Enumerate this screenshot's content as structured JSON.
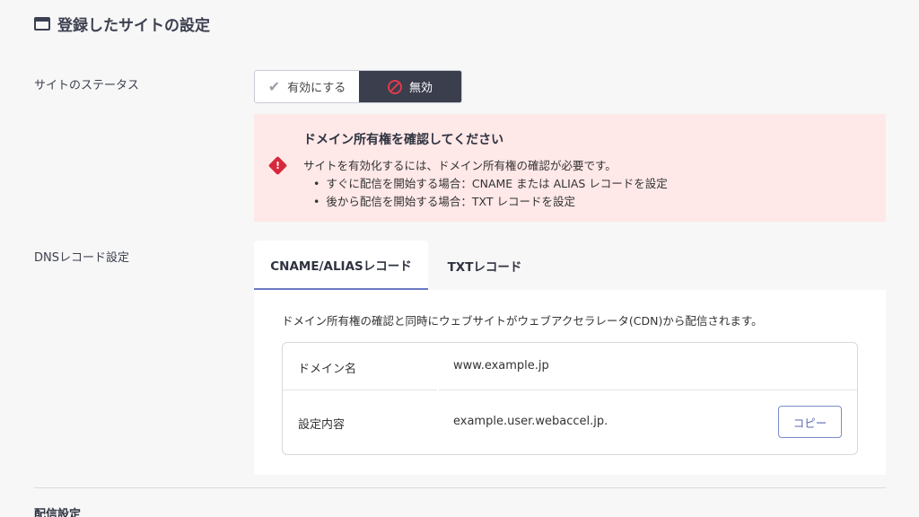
{
  "header": {
    "title": "登録したサイトの設定",
    "icon": "window-icon"
  },
  "status": {
    "label": "サイトのステータス",
    "options": [
      {
        "label": "有効にする",
        "icon": "check-icon",
        "selected": false
      },
      {
        "label": "無効",
        "icon": "ban-icon",
        "selected": true
      }
    ]
  },
  "alert": {
    "title": "ドメイン所有権を確認してください",
    "message": "サイトを有効化するには、ドメイン所有権の確認が必要です。",
    "bullets": [
      "すぐに配信を開始する場合：CNAME または ALIAS レコードを設定",
      "後から配信を開始する場合：TXT レコードを設定"
    ],
    "icon": "warning-icon",
    "color": "#d8283b"
  },
  "dns": {
    "label": "DNSレコード設定",
    "tabs": [
      {
        "label": "CNAME/ALIASレコード",
        "active": true
      },
      {
        "label": "TXTレコード",
        "active": false
      }
    ],
    "description": "ドメイン所有権の確認と同時にウェブサイトがウェブアクセラレータ(CDN)から配信されます。",
    "rows": [
      {
        "key": "ドメイン名",
        "value": "www.example.jp"
      },
      {
        "key": "設定内容",
        "value": "example.user.webaccel.jp."
      }
    ],
    "copy_label": "コピー"
  },
  "footer": {
    "section_title": "配信設定"
  },
  "colors": {
    "accent": "#6a7ac4",
    "dark_toggle": "#3a3e4d",
    "alert_bg": "#ffe8e8"
  }
}
